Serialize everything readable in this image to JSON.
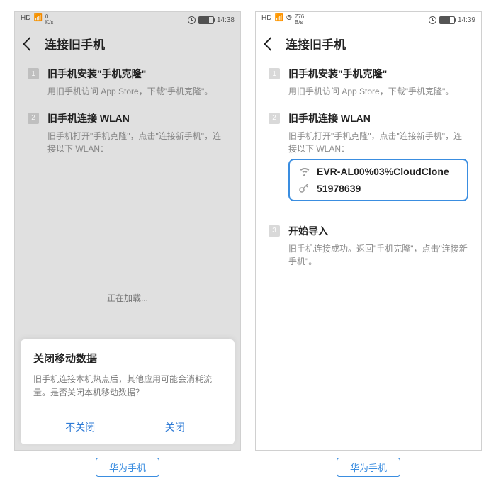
{
  "left": {
    "status": {
      "net_top": "0",
      "net_bottom": "K/s",
      "time": "14:38",
      "battery_pct": 70
    },
    "header": {
      "title": "连接旧手机"
    },
    "steps": [
      {
        "num": "1",
        "title": "旧手机安装\"手机克隆\"",
        "desc": "用旧手机访问 App Store，下载\"手机克隆\"。"
      },
      {
        "num": "2",
        "title": "旧手机连接 WLAN",
        "desc": "旧手机打开\"手机克隆\"，点击\"连接新手机\"，连接以下 WLAN："
      }
    ],
    "loading": "正在加载...",
    "sheet": {
      "title": "关闭移动数据",
      "body": "旧手机连接本机热点后，其他应用可能会消耗流量。是否关闭本机移动数据？",
      "btn_no": "不关闭",
      "btn_yes": "关闭"
    },
    "caption": "华为手机"
  },
  "right": {
    "status": {
      "net_top": "776",
      "net_bottom": "B/s",
      "time": "14:39",
      "battery_pct": 70
    },
    "header": {
      "title": "连接旧手机"
    },
    "steps": [
      {
        "num": "1",
        "title": "旧手机安装\"手机克隆\"",
        "desc": "用旧手机访问 App Store，下载\"手机克隆\"。"
      },
      {
        "num": "2",
        "title": "旧手机连接 WLAN",
        "desc": "旧手机打开\"手机克隆\"，点击\"连接新手机\"，连接以下 WLAN："
      },
      {
        "num": "3",
        "title": "开始导入",
        "desc": "旧手机连接成功。返回\"手机克隆\"，点击\"连接新手机\"。"
      }
    ],
    "wifi": {
      "ssid": "EVR-AL00%03%CloudClone",
      "password": "51978639"
    },
    "caption": "华为手机"
  },
  "status_labels": {
    "hd": "HD",
    "sig": "⁴ᴳ",
    "wave": "𝄐"
  }
}
